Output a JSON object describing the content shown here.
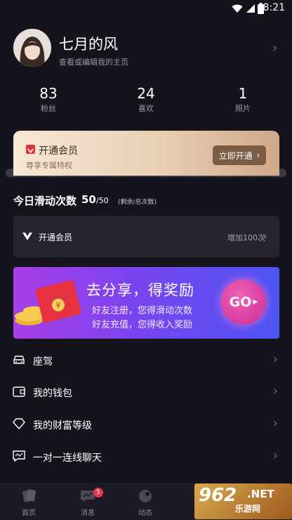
{
  "status_bar": {
    "time": "8:21"
  },
  "profile": {
    "name": "七月的风",
    "subtitle": "查看或编辑我的主页"
  },
  "stats": [
    {
      "value": "83",
      "label": "粉丝"
    },
    {
      "value": "24",
      "label": "喜欢"
    },
    {
      "value": "1",
      "label": "照片"
    }
  ],
  "vip_card": {
    "title": "开通会员",
    "subtitle": "尊享专属特权",
    "button": "立即开通"
  },
  "swipe": {
    "title": "今日滑动次数",
    "count": "50",
    "total": "/50",
    "note": "(剩余/总次数)"
  },
  "member_row": {
    "label": "开通会员",
    "right_text": "增加100次"
  },
  "banner": {
    "title": "去分享，得奖励",
    "line1": "好友注册，您得滑动次数",
    "line2": "好友充值，您得收入奖励",
    "button": "GO"
  },
  "menu": [
    {
      "label": "座驾",
      "icon": "car-icon"
    },
    {
      "label": "我的钱包",
      "icon": "wallet-icon"
    },
    {
      "label": "我的财富等级",
      "icon": "diamond-icon"
    },
    {
      "label": "一对一连线聊天",
      "icon": "chat-icon"
    }
  ],
  "tabs": [
    {
      "label": "首页",
      "icon": "cards-icon"
    },
    {
      "label": "消息",
      "icon": "message-icon",
      "badge": "5"
    },
    {
      "label": "动态",
      "icon": "moments-icon"
    }
  ],
  "watermark": {
    "brand": "962",
    "tld": ".NET",
    "site": "乐游网"
  },
  "colors": {
    "background": "#15141d",
    "accent_vip": "#7a5b43",
    "badge": "#e8344a"
  }
}
